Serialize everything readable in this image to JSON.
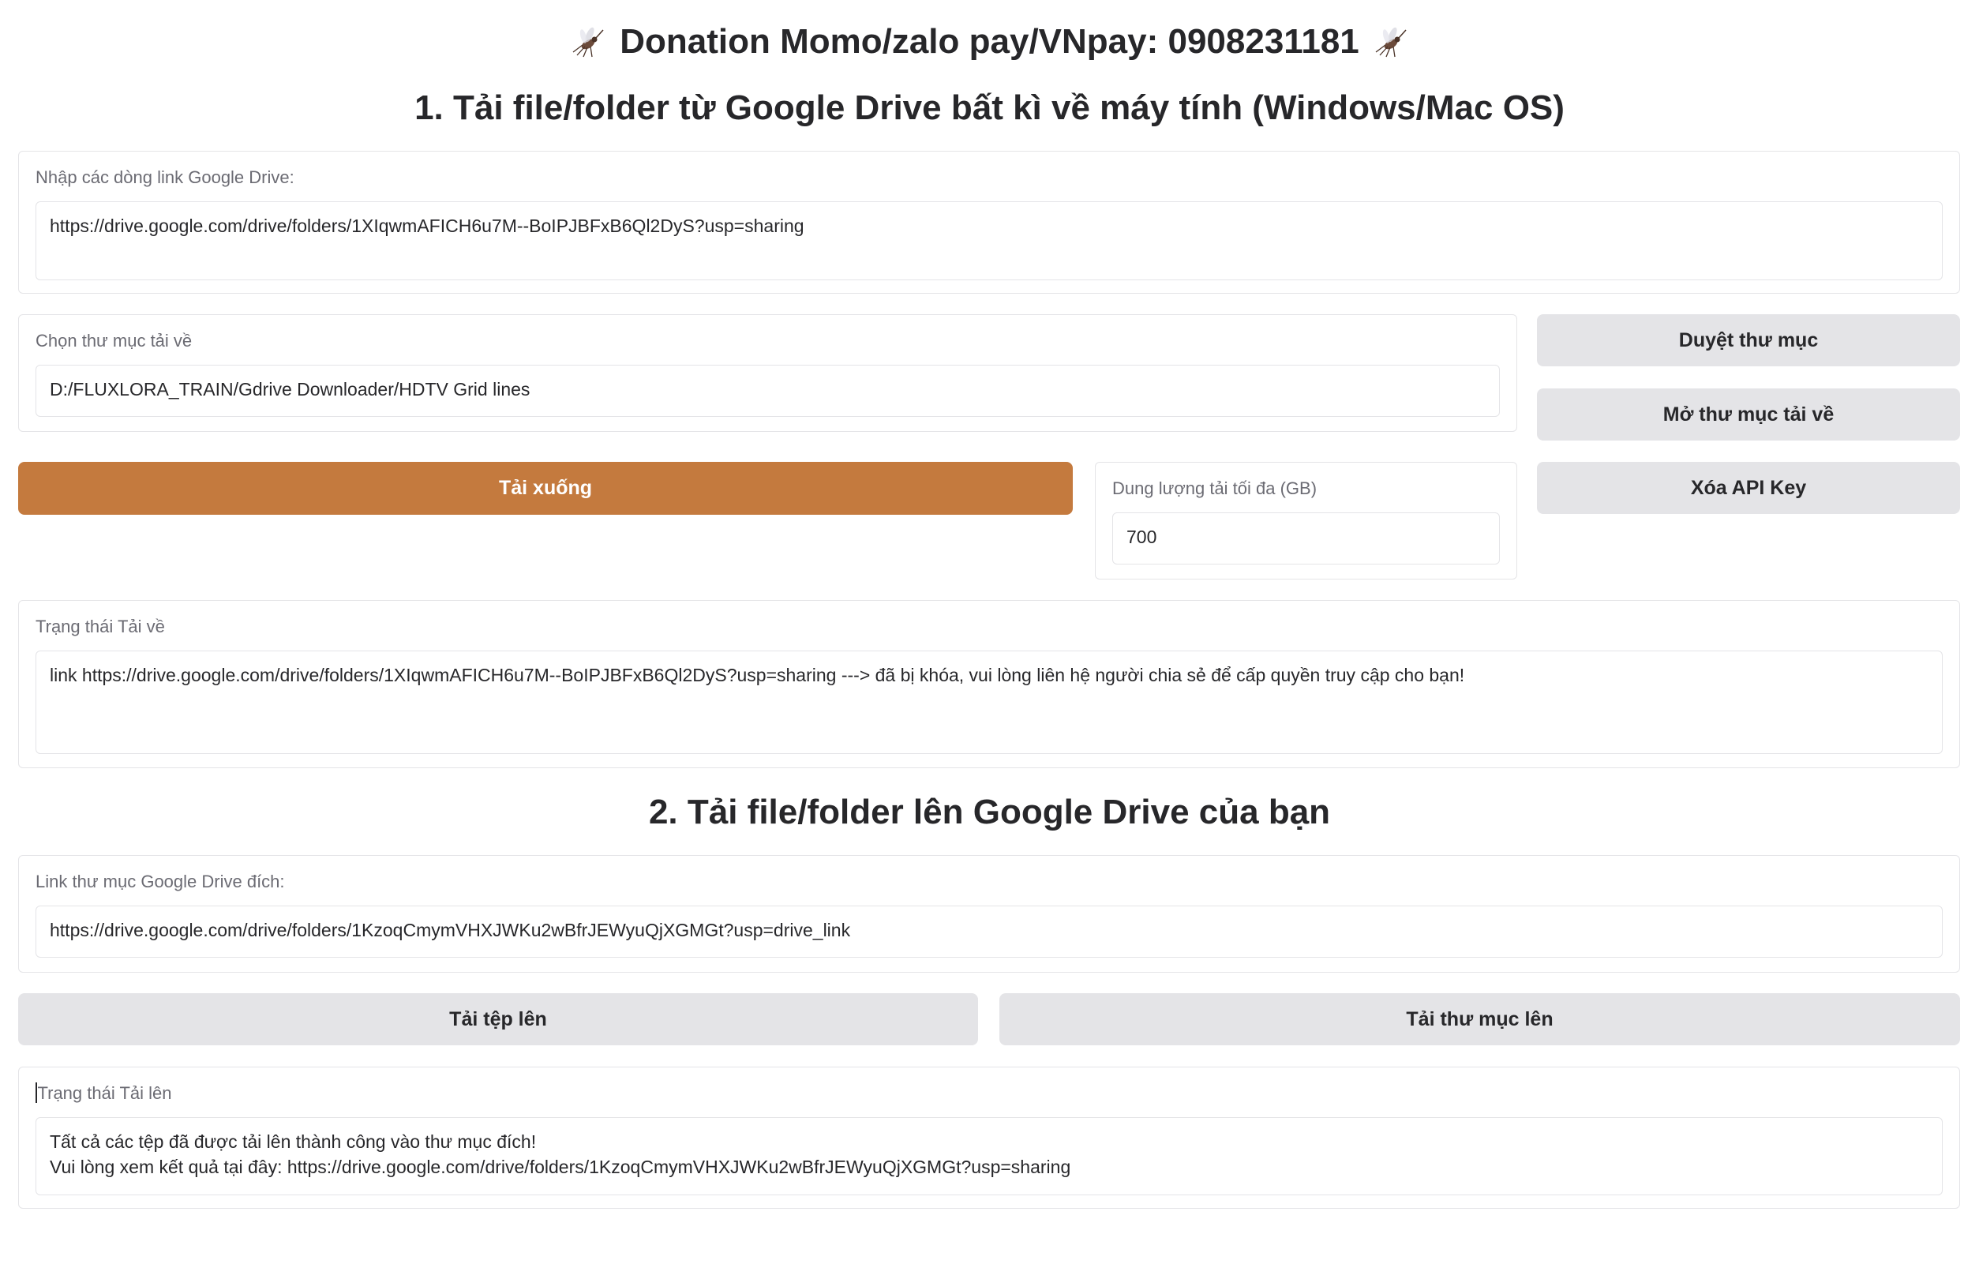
{
  "header": {
    "donation": "Donation Momo/zalo pay/VNpay: 0908231181",
    "section1_title": "1. Tải file/folder từ Google Drive bất kì về máy tính (Windows/Mac OS)",
    "section2_title": "2. Tải file/folder lên Google Drive của bạn"
  },
  "download": {
    "links_label": "Nhập các dòng link Google Drive:",
    "links_value": "https://drive.google.com/drive/folders/1XIqwmAFICH6u7M--BoIPJBFxB6Ql2DyS?usp=sharing",
    "folder_label": "Chọn thư mục tải về",
    "folder_value": "D:/FLUXLORA_TRAIN/Gdrive Downloader/HDTV Grid lines",
    "browse_button": "Duyệt thư mục",
    "open_folder_button": "Mở thư mục tải về",
    "clear_api_button": "Xóa API Key",
    "download_button": "Tải xuống",
    "max_size_label": "Dung lượng tải tối đa (GB)",
    "max_size_value": "700",
    "status_label": "Trạng thái Tải về",
    "status_value": "link https://drive.google.com/drive/folders/1XIqwmAFICH6u7M--BoIPJBFxB6Ql2DyS?usp=sharing ---> đã bị khóa, vui lòng liên hệ người chia sẻ để cấp quyền truy cập cho bạn!"
  },
  "upload": {
    "dest_label": "Link thư mục Google Drive đích:",
    "dest_value": "https://drive.google.com/drive/folders/1KzoqCmymVHXJWKu2wBfrJEWyuQjXGMGt?usp=drive_link",
    "upload_file_button": "Tải tệp lên",
    "upload_folder_button": "Tải thư mục lên",
    "status_label": "Trạng thái Tải lên",
    "status_value": "Tất cả các tệp đã được tải lên thành công vào thư mục đích!\nVui lòng xem kết quả tại đây: https://drive.google.com/drive/folders/1KzoqCmymVHXJWKu2wBfrJEWyuQjXGMGt?usp=sharing"
  },
  "colors": {
    "primary_button": "#c47a3e",
    "secondary_button": "#e4e4e7",
    "border": "#e4e4e7"
  },
  "icons": [
    "mosquito-icon"
  ]
}
